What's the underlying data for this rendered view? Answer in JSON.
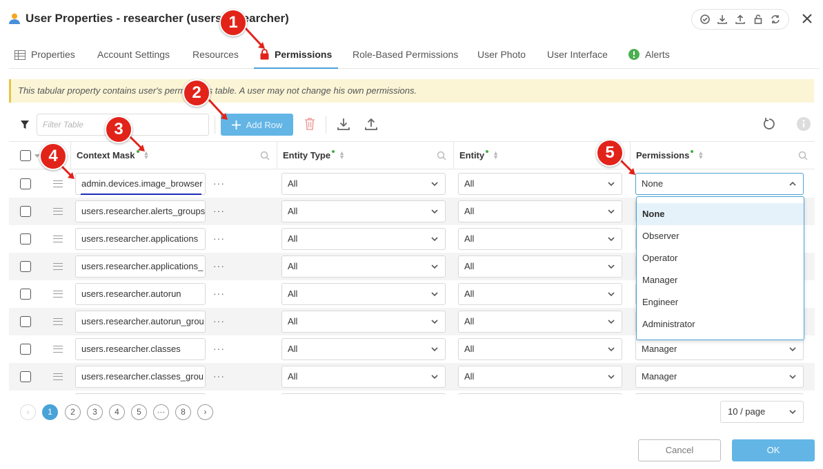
{
  "window": {
    "title": "User Properties - researcher (users.researcher)"
  },
  "tabs": [
    {
      "label": "Properties",
      "icon": "table-icon"
    },
    {
      "label": "Account Settings"
    },
    {
      "label": "Resources"
    },
    {
      "label": "Permissions",
      "icon": "lock-icon",
      "active": true
    },
    {
      "label": "Role-Based Permissions"
    },
    {
      "label": "User Photo"
    },
    {
      "label": "User Interface"
    },
    {
      "label": "Alerts",
      "icon": "alert-icon"
    }
  ],
  "notice": "This tabular property contains user's permissions table. A user may not change his own permissions.",
  "toolbar": {
    "filter_placeholder": "Filter Table",
    "add_row_label": "Add Row"
  },
  "columns": {
    "context_mask": "Context Mask",
    "entity_type": "Entity Type",
    "entity": "Entity",
    "permissions": "Permissions"
  },
  "rows": [
    {
      "context_mask": "admin.devices.image_browser",
      "entity_type": "All",
      "entity": "All",
      "permissions": "None"
    },
    {
      "context_mask": "users.researcher.alerts_groups",
      "entity_type": "All",
      "entity": "All",
      "permissions": ""
    },
    {
      "context_mask": "users.researcher.applications",
      "entity_type": "All",
      "entity": "All",
      "permissions": ""
    },
    {
      "context_mask": "users.researcher.applications_",
      "entity_type": "All",
      "entity": "All",
      "permissions": ""
    },
    {
      "context_mask": "users.researcher.autorun",
      "entity_type": "All",
      "entity": "All",
      "permissions": ""
    },
    {
      "context_mask": "users.researcher.autorun_grou",
      "entity_type": "All",
      "entity": "All",
      "permissions": ""
    },
    {
      "context_mask": "users.researcher.classes",
      "entity_type": "All",
      "entity": "All",
      "permissions": "Manager"
    },
    {
      "context_mask": "users.researcher.classes_grou",
      "entity_type": "All",
      "entity": "All",
      "permissions": "Manager"
    }
  ],
  "permission_options": [
    "None",
    "Observer",
    "Operator",
    "Manager",
    "Engineer",
    "Administrator"
  ],
  "pagination": {
    "pages": [
      "1",
      "2",
      "3",
      "4",
      "5",
      "···",
      "8"
    ],
    "current": "1",
    "page_size": "10 / page"
  },
  "buttons": {
    "cancel": "Cancel",
    "ok": "OK"
  },
  "callouts": [
    "1",
    "2",
    "3",
    "4",
    "5"
  ],
  "colors": {
    "accent": "#4aa3d8",
    "callout": "#e2231a",
    "notice_bg": "#fbf5d6"
  }
}
